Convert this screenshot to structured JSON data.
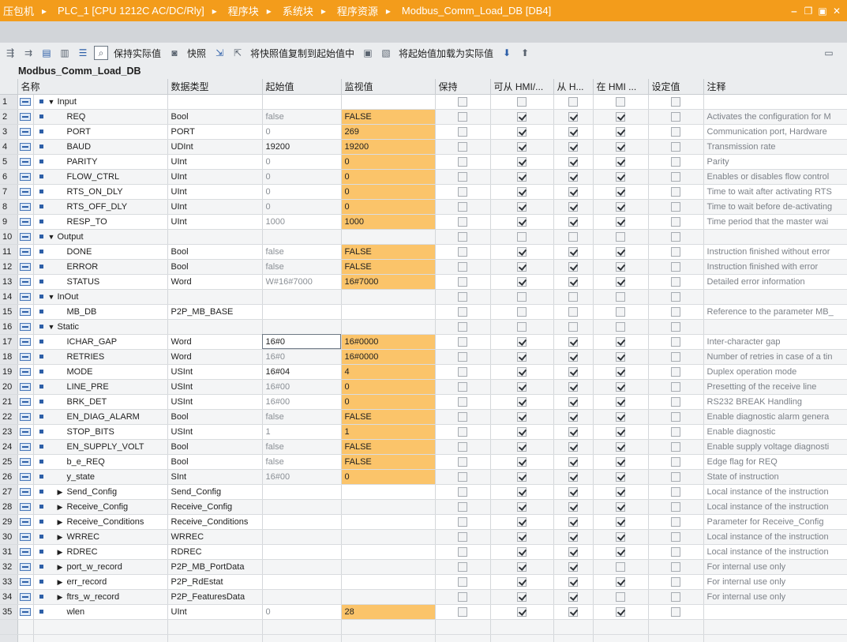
{
  "titlebar": {
    "crumbs": [
      "压包机",
      "PLC_1 [CPU 1212C AC/DC/Rly]",
      "程序块",
      "系统块",
      "程序资源",
      "Modbus_Comm_Load_DB [DB4]"
    ],
    "separator": "▸"
  },
  "toolbar": {
    "keep_actual": "保持实际值",
    "snapshot": "快照",
    "copy_snapshot": "将快照值复制到起始值中",
    "load_start": "将起始值加载为实际值"
  },
  "block_title": "Modbus_Comm_Load_DB",
  "columns": [
    "名称",
    "数据类型",
    "起始值",
    "监视值",
    "保持",
    "可从 HMI/...",
    "从 H...",
    "在 HMI ...",
    "设定值",
    "注释"
  ],
  "rows": [
    {
      "n": "1",
      "kind": "section",
      "name": "Input",
      "type": "",
      "start": "",
      "mon": "",
      "hmi": [
        false,
        false,
        false
      ],
      "cmt": ""
    },
    {
      "n": "2",
      "kind": "var",
      "name": "REQ",
      "type": "Bool",
      "start": "false",
      "mon": "FALSE",
      "hmi": [
        true,
        true,
        true
      ],
      "cmt": "Activates the configuration for M"
    },
    {
      "n": "3",
      "kind": "var",
      "name": "PORT",
      "type": "PORT",
      "start": "0",
      "mon": "269",
      "hmi": [
        true,
        true,
        true
      ],
      "cmt": "Communication port, Hardware"
    },
    {
      "n": "4",
      "kind": "var",
      "name": "BAUD",
      "type": "UDInt",
      "start": "19200",
      "startDark": true,
      "mon": "19200",
      "hmi": [
        true,
        true,
        true
      ],
      "cmt": "Transmission rate"
    },
    {
      "n": "5",
      "kind": "var",
      "name": "PARITY",
      "type": "UInt",
      "start": "0",
      "mon": "0",
      "hmi": [
        true,
        true,
        true
      ],
      "cmt": "Parity"
    },
    {
      "n": "6",
      "kind": "var",
      "name": "FLOW_CTRL",
      "type": "UInt",
      "start": "0",
      "mon": "0",
      "hmi": [
        true,
        true,
        true
      ],
      "cmt": "Enables or disables flow control"
    },
    {
      "n": "7",
      "kind": "var",
      "name": "RTS_ON_DLY",
      "type": "UInt",
      "start": "0",
      "mon": "0",
      "hmi": [
        true,
        true,
        true
      ],
      "cmt": "Time to wait after activating RTS"
    },
    {
      "n": "8",
      "kind": "var",
      "name": "RTS_OFF_DLY",
      "type": "UInt",
      "start": "0",
      "mon": "0",
      "hmi": [
        true,
        true,
        true
      ],
      "cmt": "Time to wait before de-activating"
    },
    {
      "n": "9",
      "kind": "var",
      "name": "RESP_TO",
      "type": "UInt",
      "start": "1000",
      "mon": "1000",
      "hmi": [
        true,
        true,
        true
      ],
      "cmt": "Time period that the master wai"
    },
    {
      "n": "10",
      "kind": "section",
      "name": "Output",
      "type": "",
      "start": "",
      "mon": "",
      "hmi": [
        false,
        false,
        false
      ],
      "cmt": ""
    },
    {
      "n": "11",
      "kind": "var",
      "name": "DONE",
      "type": "Bool",
      "start": "false",
      "mon": "FALSE",
      "hmi": [
        true,
        true,
        true
      ],
      "cmt": "Instruction finished without error"
    },
    {
      "n": "12",
      "kind": "var",
      "name": "ERROR",
      "type": "Bool",
      "start": "false",
      "mon": "FALSE",
      "hmi": [
        true,
        true,
        true
      ],
      "cmt": "Instruction finished with error"
    },
    {
      "n": "13",
      "kind": "var",
      "name": "STATUS",
      "type": "Word",
      "start": "W#16#7000",
      "mon": "16#7000",
      "hmi": [
        true,
        true,
        true
      ],
      "cmt": "Detailed error information"
    },
    {
      "n": "14",
      "kind": "section",
      "name": "InOut",
      "type": "",
      "start": "",
      "mon": "",
      "hmi": [
        false,
        false,
        false
      ],
      "cmt": ""
    },
    {
      "n": "15",
      "kind": "var",
      "name": "MB_DB",
      "type": "P2P_MB_BASE",
      "start": "",
      "mon": "",
      "hmi": [
        false,
        false,
        false
      ],
      "cmt": "Reference to the parameter MB_"
    },
    {
      "n": "16",
      "kind": "section",
      "name": "Static",
      "type": "",
      "start": "",
      "mon": "",
      "hmi": [
        false,
        false,
        false
      ],
      "cmt": ""
    },
    {
      "n": "17",
      "kind": "var",
      "name": "ICHAR_GAP",
      "type": "Word",
      "start": "16#0",
      "startSel": true,
      "mon": "16#0000",
      "hmi": [
        true,
        true,
        true
      ],
      "cmt": "Inter-character gap"
    },
    {
      "n": "18",
      "kind": "var",
      "name": "RETRIES",
      "type": "Word",
      "start": "16#0",
      "mon": "16#0000",
      "hmi": [
        true,
        true,
        true
      ],
      "cmt": "Number of retries in case of a tin"
    },
    {
      "n": "19",
      "kind": "var",
      "name": "MODE",
      "type": "USInt",
      "start": "16#04",
      "startDark": true,
      "mon": "4",
      "hmi": [
        true,
        true,
        true
      ],
      "cmt": "Duplex operation mode"
    },
    {
      "n": "20",
      "kind": "var",
      "name": "LINE_PRE",
      "type": "USInt",
      "start": "16#00",
      "mon": "0",
      "hmi": [
        true,
        true,
        true
      ],
      "cmt": "Presetting of the receive line"
    },
    {
      "n": "21",
      "kind": "var",
      "name": "BRK_DET",
      "type": "USInt",
      "start": "16#00",
      "mon": "0",
      "hmi": [
        true,
        true,
        true
      ],
      "cmt": "RS232 BREAK Handling"
    },
    {
      "n": "22",
      "kind": "var",
      "name": "EN_DIAG_ALARM",
      "type": "Bool",
      "start": "false",
      "mon": "FALSE",
      "hmi": [
        true,
        true,
        true
      ],
      "cmt": "Enable diagnostic alarm genera"
    },
    {
      "n": "23",
      "kind": "var",
      "name": "STOP_BITS",
      "type": "USInt",
      "start": "1",
      "mon": "1",
      "hmi": [
        true,
        true,
        true
      ],
      "cmt": "Enable diagnostic"
    },
    {
      "n": "24",
      "kind": "var",
      "name": "EN_SUPPLY_VOLT",
      "type": "Bool",
      "start": "false",
      "mon": "FALSE",
      "hmi": [
        true,
        true,
        true
      ],
      "cmt": "Enable supply voltage diagnosti"
    },
    {
      "n": "25",
      "kind": "var",
      "name": "b_e_REQ",
      "type": "Bool",
      "start": "false",
      "mon": "FALSE",
      "hmi": [
        true,
        true,
        true
      ],
      "cmt": "Edge flag for REQ"
    },
    {
      "n": "26",
      "kind": "var",
      "name": "y_state",
      "type": "SInt",
      "start": "16#00",
      "mon": "0",
      "hmi": [
        true,
        true,
        true
      ],
      "cmt": "State of instruction"
    },
    {
      "n": "27",
      "kind": "struct",
      "name": "Send_Config",
      "type": "Send_Config",
      "start": "",
      "mon": "",
      "hmi": [
        true,
        true,
        true
      ],
      "cmt": "Local instance of the instruction"
    },
    {
      "n": "28",
      "kind": "struct",
      "name": "Receive_Config",
      "type": "Receive_Config",
      "start": "",
      "mon": "",
      "hmi": [
        true,
        true,
        true
      ],
      "cmt": "Local instance of the instruction"
    },
    {
      "n": "29",
      "kind": "struct",
      "name": "Receive_Conditions",
      "type": "Receive_Conditions",
      "start": "",
      "mon": "",
      "hmi": [
        true,
        true,
        true
      ],
      "cmt": "Parameter for Receive_Config"
    },
    {
      "n": "30",
      "kind": "struct",
      "name": "WRREC",
      "type": "WRREC",
      "start": "",
      "mon": "",
      "hmi": [
        true,
        true,
        true
      ],
      "cmt": "Local instance of the instruction"
    },
    {
      "n": "31",
      "kind": "struct",
      "name": "RDREC",
      "type": "RDREC",
      "start": "",
      "mon": "",
      "hmi": [
        true,
        true,
        true
      ],
      "cmt": "Local instance of the instruction"
    },
    {
      "n": "32",
      "kind": "struct",
      "name": "port_w_record",
      "type": "P2P_MB_PortData",
      "start": "",
      "mon": "",
      "hmi": [
        true,
        true,
        false
      ],
      "cmt": "For internal use only"
    },
    {
      "n": "33",
      "kind": "struct",
      "name": "err_record",
      "type": "P2P_RdEstat",
      "start": "",
      "mon": "",
      "hmi": [
        true,
        true,
        true
      ],
      "cmt": "For internal use only"
    },
    {
      "n": "34",
      "kind": "struct",
      "name": "ftrs_w_record",
      "type": "P2P_FeaturesData",
      "start": "",
      "mon": "",
      "hmi": [
        true,
        true,
        false
      ],
      "cmt": "For internal use only"
    },
    {
      "n": "35",
      "kind": "var",
      "name": "wlen",
      "type": "UInt",
      "start": "0",
      "mon": "28",
      "hmi": [
        true,
        true,
        true
      ],
      "cmt": ""
    }
  ]
}
